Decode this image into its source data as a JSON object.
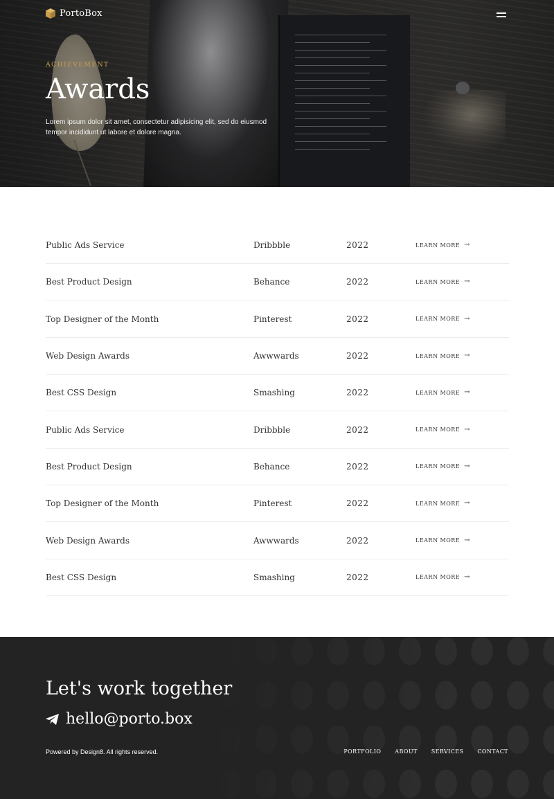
{
  "brand": {
    "name": "PortoBox",
    "accent": "#c99f4f"
  },
  "header": {
    "menu_icon": "hamburger-icon"
  },
  "hero": {
    "eyebrow": "Achievement",
    "title": "Awards",
    "description": "Lorem ipsum dolor sit amet, consectetur adipisicing elit, sed do eiusmod tempor incididunt ut labore et dolore magna."
  },
  "awards": [
    {
      "name": "Public Ads Service",
      "platform": "Dribbble",
      "year": "2022",
      "link": "Learn More"
    },
    {
      "name": "Best Product Design",
      "platform": "Behance",
      "year": "2022",
      "link": "Learn More"
    },
    {
      "name": "Top Designer of the Month",
      "platform": "Pinterest",
      "year": "2022",
      "link": "Learn More"
    },
    {
      "name": "Web Design Awards",
      "platform": "Awwwards",
      "year": "2022",
      "link": "Learn More"
    },
    {
      "name": "Best CSS Design",
      "platform": "Smashing",
      "year": "2022",
      "link": "Learn More"
    },
    {
      "name": "Public Ads Service",
      "platform": "Dribbble",
      "year": "2022",
      "link": "Learn More"
    },
    {
      "name": "Best Product Design",
      "platform": "Behance",
      "year": "2022",
      "link": "Learn More"
    },
    {
      "name": "Top Designer of the Month",
      "platform": "Pinterest",
      "year": "2022",
      "link": "Learn More"
    },
    {
      "name": "Web Design Awards",
      "platform": "Awwwards",
      "year": "2022",
      "link": "Learn More"
    },
    {
      "name": "Best CSS Design",
      "platform": "Smashing",
      "year": "2022",
      "link": "Learn More"
    }
  ],
  "footer": {
    "title": "Let's work together",
    "email": "hello@porto.box",
    "copyright": "Powered by Design8. All rights reserved.",
    "nav": [
      "Portfolio",
      "About",
      "Services",
      "Contact"
    ],
    "background": "#232323"
  }
}
